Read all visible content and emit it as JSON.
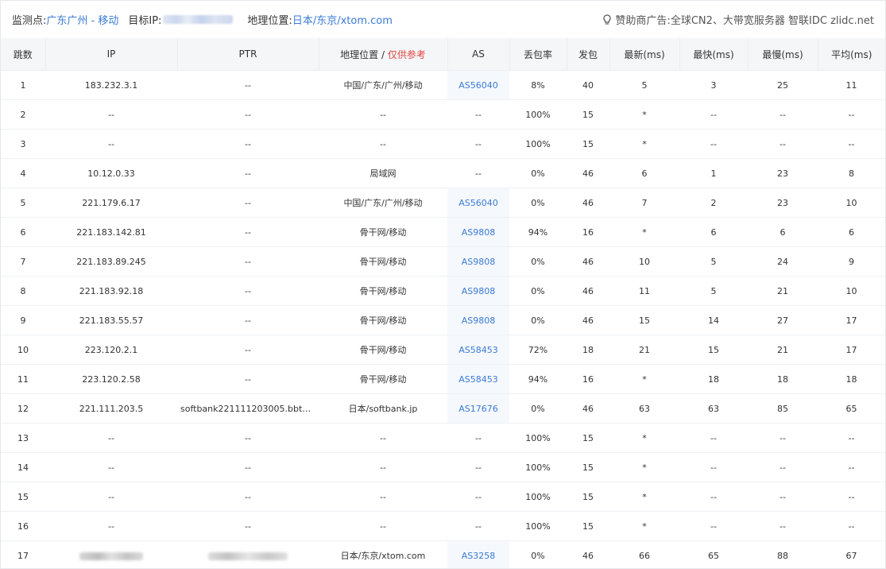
{
  "header": {
    "monitor_label": "监测点:",
    "monitor_value": "广东广州 - 移动",
    "target_label": "目标IP:",
    "geo_label": "地理位置:",
    "geo_value": "日本/东京/xtom.com",
    "sponsor_label": "赞助商广告:",
    "sponsor_text": "全球CN2、大带宽服务器 智联IDC zlidc.net",
    "sponsor_icon": "lightbulb-icon"
  },
  "columns": {
    "hop": "跳数",
    "ip": "IP",
    "ptr": "PTR",
    "geo": "地理位置 / ",
    "geo_note": "仅供参考",
    "as": "AS",
    "loss": "丢包率",
    "sent": "发包",
    "last": "最新(ms)",
    "best": "最快(ms)",
    "worst": "最慢(ms)",
    "avg": "平均(ms)"
  },
  "colors": {
    "accent": "#3a7bd5",
    "note_red": "#e0463e",
    "header_bg": "#f5f6f8"
  },
  "rows": [
    {
      "hop": "1",
      "ip": "183.232.3.1",
      "ptr": "--",
      "geo": "中国/广东/广州/移动",
      "as": "AS56040",
      "loss": "8%",
      "sent": "40",
      "last": "5",
      "best": "3",
      "worst": "25",
      "avg": "11"
    },
    {
      "hop": "2",
      "ip": "--",
      "ptr": "--",
      "geo": "--",
      "as": "--",
      "loss": "100%",
      "sent": "15",
      "last": "*",
      "best": "--",
      "worst": "--",
      "avg": "--"
    },
    {
      "hop": "3",
      "ip": "--",
      "ptr": "--",
      "geo": "--",
      "as": "--",
      "loss": "100%",
      "sent": "15",
      "last": "*",
      "best": "--",
      "worst": "--",
      "avg": "--"
    },
    {
      "hop": "4",
      "ip": "10.12.0.33",
      "ptr": "--",
      "geo": "局域网",
      "as": "--",
      "loss": "0%",
      "sent": "46",
      "last": "6",
      "best": "1",
      "worst": "23",
      "avg": "8"
    },
    {
      "hop": "5",
      "ip": "221.179.6.17",
      "ptr": "--",
      "geo": "中国/广东/广州/移动",
      "as": "AS56040",
      "loss": "0%",
      "sent": "46",
      "last": "7",
      "best": "2",
      "worst": "23",
      "avg": "10"
    },
    {
      "hop": "6",
      "ip": "221.183.142.81",
      "ptr": "--",
      "geo": "骨干网/移动",
      "as": "AS9808",
      "loss": "94%",
      "sent": "16",
      "last": "*",
      "best": "6",
      "worst": "6",
      "avg": "6"
    },
    {
      "hop": "7",
      "ip": "221.183.89.245",
      "ptr": "--",
      "geo": "骨干网/移动",
      "as": "AS9808",
      "loss": "0%",
      "sent": "46",
      "last": "10",
      "best": "5",
      "worst": "24",
      "avg": "9"
    },
    {
      "hop": "8",
      "ip": "221.183.92.18",
      "ptr": "--",
      "geo": "骨干网/移动",
      "as": "AS9808",
      "loss": "0%",
      "sent": "46",
      "last": "11",
      "best": "5",
      "worst": "21",
      "avg": "10"
    },
    {
      "hop": "9",
      "ip": "221.183.55.57",
      "ptr": "--",
      "geo": "骨干网/移动",
      "as": "AS9808",
      "loss": "0%",
      "sent": "46",
      "last": "15",
      "best": "14",
      "worst": "27",
      "avg": "17"
    },
    {
      "hop": "10",
      "ip": "223.120.2.1",
      "ptr": "--",
      "geo": "骨干网/移动",
      "as": "AS58453",
      "loss": "72%",
      "sent": "18",
      "last": "21",
      "best": "15",
      "worst": "21",
      "avg": "17"
    },
    {
      "hop": "11",
      "ip": "223.120.2.58",
      "ptr": "--",
      "geo": "骨干网/移动",
      "as": "AS58453",
      "loss": "94%",
      "sent": "16",
      "last": "*",
      "best": "18",
      "worst": "18",
      "avg": "18"
    },
    {
      "hop": "12",
      "ip": "221.111.203.5",
      "ptr": "softbank221111203005.bbtec...",
      "geo": "日本/softbank.jp",
      "as": "AS17676",
      "loss": "0%",
      "sent": "46",
      "last": "63",
      "best": "63",
      "worst": "85",
      "avg": "65"
    },
    {
      "hop": "13",
      "ip": "--",
      "ptr": "--",
      "geo": "--",
      "as": "--",
      "loss": "100%",
      "sent": "15",
      "last": "*",
      "best": "--",
      "worst": "--",
      "avg": "--"
    },
    {
      "hop": "14",
      "ip": "--",
      "ptr": "--",
      "geo": "--",
      "as": "--",
      "loss": "100%",
      "sent": "15",
      "last": "*",
      "best": "--",
      "worst": "--",
      "avg": "--"
    },
    {
      "hop": "15",
      "ip": "--",
      "ptr": "--",
      "geo": "--",
      "as": "--",
      "loss": "100%",
      "sent": "15",
      "last": "*",
      "best": "--",
      "worst": "--",
      "avg": "--"
    },
    {
      "hop": "16",
      "ip": "--",
      "ptr": "--",
      "geo": "--",
      "as": "--",
      "loss": "100%",
      "sent": "15",
      "last": "*",
      "best": "--",
      "worst": "--",
      "avg": "--"
    },
    {
      "hop": "17",
      "ip": "",
      "ptr": "",
      "geo": "日本/东京/xtom.com",
      "as": "AS3258",
      "loss": "0%",
      "sent": "46",
      "last": "66",
      "best": "65",
      "worst": "88",
      "avg": "67"
    }
  ]
}
